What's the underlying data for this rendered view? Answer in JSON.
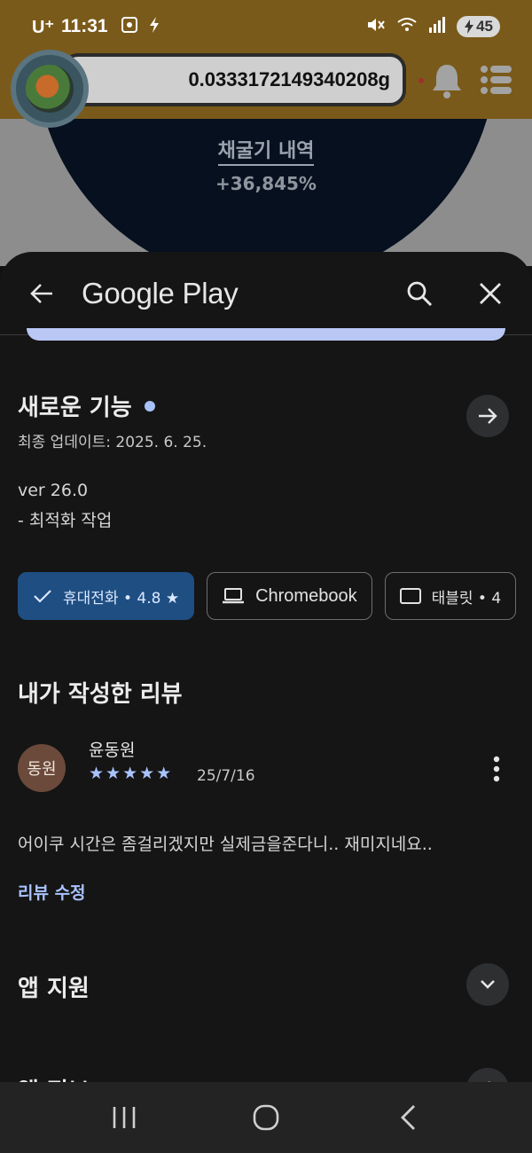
{
  "status_bar": {
    "carrier": "U⁺",
    "time": "11:31",
    "battery": "45"
  },
  "background_app": {
    "balance": "0.0333172149340208g",
    "link_text": "채굴기 내역",
    "percent_text": "+36,845%"
  },
  "sheet": {
    "title": "Google Play",
    "whats_new": {
      "title": "새로운 기능",
      "updated": "최종 업데이트: 2025. 6. 25.",
      "version": "ver 26.0",
      "notes": "- 최적화 작업"
    },
    "device_chips": [
      {
        "label": "휴대전화 • 4.8 ★",
        "selected": true,
        "icon": "check-icon"
      },
      {
        "label": "Chromebook",
        "selected": false,
        "icon": "laptop-icon"
      },
      {
        "label": "태블릿 • 4",
        "selected": false,
        "icon": "tablet-icon"
      }
    ],
    "my_review": {
      "title": "내가 작성한 리뷰",
      "avatar_text": "동원",
      "name": "윤동원",
      "stars": "★★★★★",
      "rating": 5,
      "date": "25/7/16",
      "text": "어이쿠 시간은 좀걸리겠지만 실제금을준다니.. 재미지네요..",
      "edit_label": "리뷰 수정"
    },
    "app_support": "앱 지원",
    "app_info": "앱 정보"
  },
  "colors": {
    "accent": "#a9c3ff",
    "chip_selected": "#1e4e82",
    "topbar": "#7a5a1a"
  }
}
